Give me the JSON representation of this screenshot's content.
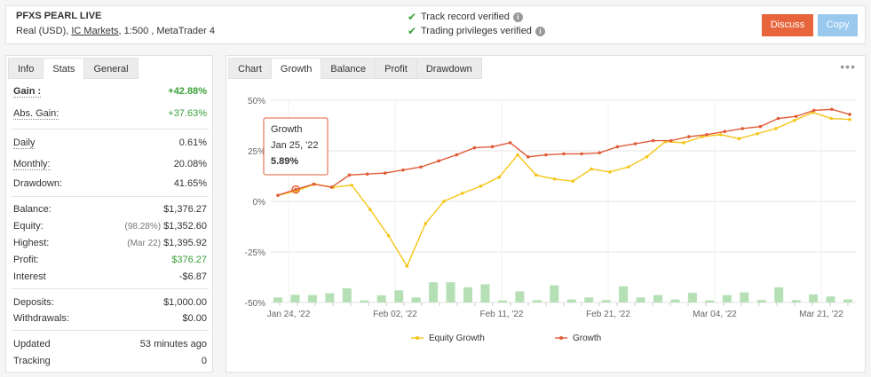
{
  "account": {
    "name": "PFXS PEARL LIVE",
    "type": "Real (USD),",
    "broker": "IC Markets",
    "details": ", 1:500 , MetaTrader 4"
  },
  "verification": {
    "track_record": "Track record verified",
    "trading_privileges": "Trading privileges verified",
    "check_color": "#3aa03a"
  },
  "buttons": {
    "discuss": "Discuss",
    "copy": "Copy",
    "discuss_color": "#e8643d",
    "copy_color": "#9ac9ee"
  },
  "left_tabs": [
    "Info",
    "Stats",
    "General"
  ],
  "left_active_tab": "Stats",
  "stats": {
    "gain_label": "Gain :",
    "gain_value": "+42.88%",
    "abs_gain_label": "Abs. Gain:",
    "abs_gain_value": "+37.63%",
    "daily_label": "Daily",
    "daily_value": "0.61%",
    "monthly_label": "Monthly:",
    "monthly_value": "20.08%",
    "drawdown_label": "Drawdown:",
    "drawdown_value": "41.65%",
    "balance_label": "Balance:",
    "balance_value": "$1,376.27",
    "equity_label": "Equity:",
    "equity_sub": "(98.28%)",
    "equity_value": "$1,352.60",
    "highest_label": "Highest:",
    "highest_sub": "(Mar 22)",
    "highest_value": "$1,395.92",
    "profit_label": "Profit:",
    "profit_value": "$376.27",
    "interest_label": "Interest",
    "interest_value": "-$6.87",
    "deposits_label": "Deposits:",
    "deposits_value": "$1,000.00",
    "withdrawals_label": "Withdrawals:",
    "withdrawals_value": "$0.00",
    "updated_label": "Updated",
    "updated_value": "53 minutes ago",
    "tracking_label": "Tracking",
    "tracking_value": "0"
  },
  "right_tabs": [
    "Chart",
    "Growth",
    "Balance",
    "Profit",
    "Drawdown"
  ],
  "right_active_tab": "Growth",
  "menu_icon": "more-dots-icon",
  "tooltip": {
    "series": "Growth",
    "date": "Jan 25, '22",
    "value": "5.89%"
  },
  "chart_data": {
    "type": "line",
    "x_tick_labels": [
      "Jan 24, '22",
      "Feb 02, '22",
      "Feb 11, '22",
      "Feb 21, '22",
      "Mar 04, '22",
      "Mar 21, '22"
    ],
    "y_tick_labels": [
      "50%",
      "25%",
      "0%",
      "-25%",
      "-50%"
    ],
    "ylim": [
      -50,
      50
    ],
    "grid": true,
    "legend_position": "bottom",
    "series": [
      {
        "name": "Equity Growth",
        "color": "#f5c518",
        "values": [
          3,
          5.2,
          8.5,
          7,
          8,
          -4,
          -17,
          -32,
          -11,
          0,
          4,
          7.5,
          12,
          23,
          13,
          11,
          10,
          16,
          14.5,
          17,
          22,
          29.5,
          29,
          32,
          33,
          31,
          33.5,
          36,
          40,
          44,
          41,
          40.5
        ]
      },
      {
        "name": "Growth",
        "color": "#e05c38",
        "values": [
          3,
          5.89,
          8.5,
          7,
          13,
          13.5,
          14,
          15.5,
          17,
          20,
          23,
          26.5,
          27,
          29,
          22,
          23,
          23.5,
          23.5,
          24,
          27,
          28.5,
          30,
          30,
          32,
          33,
          34.5,
          36,
          37,
          41,
          42,
          45,
          45.5,
          43
        ]
      }
    ],
    "bars": {
      "color": "#b5e0b5",
      "values": [
        2.5,
        3.8,
        3.7,
        4.6,
        7,
        1,
        3.5,
        6,
        2.5,
        10,
        10,
        7.5,
        9,
        1,
        5.5,
        1.2,
        8.5,
        1.5,
        2.5,
        1.2,
        8,
        2.5,
        3.7,
        1.5,
        4.8,
        1,
        3.7,
        5,
        1.2,
        7.5,
        1.2,
        4,
        3,
        1.5
      ]
    }
  }
}
